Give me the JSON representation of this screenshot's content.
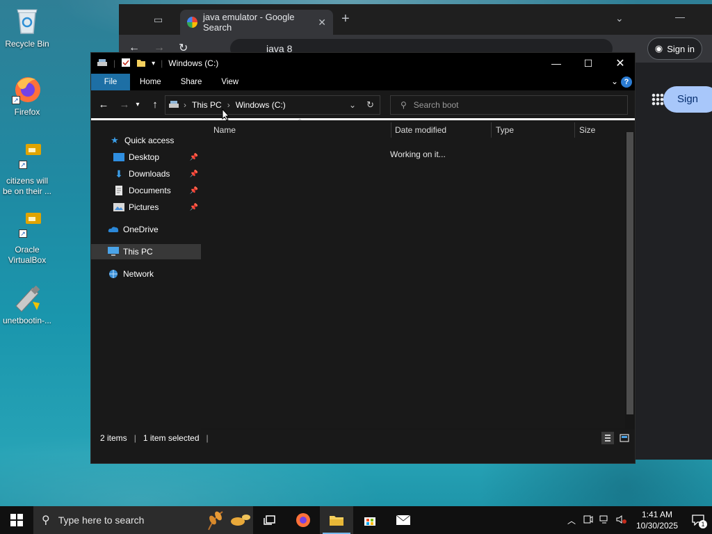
{
  "desktop": {
    "icons": [
      {
        "label": "Recycle Bin"
      },
      {
        "label": "Firefox"
      },
      {
        "label": "citizens will be on their ..."
      },
      {
        "label": "Oracle VirtualBox"
      },
      {
        "label": "unetbootin-..."
      }
    ]
  },
  "browser": {
    "tab_title": "java emulator - Google Search",
    "omnibox_text": "java 8",
    "signin_label": "Sign in",
    "signin_big_label": "Sign"
  },
  "explorer": {
    "window_title": "Windows (C:)",
    "ribbon_tabs": [
      "File",
      "Home",
      "Share",
      "View"
    ],
    "breadcrumb": [
      "This PC",
      "Windows (C:)"
    ],
    "search_placeholder": "Search boot",
    "nav": {
      "quick_access": "Quick access",
      "desktop": "Desktop",
      "downloads": "Downloads",
      "documents": "Documents",
      "pictures": "Pictures",
      "onedrive": "OneDrive",
      "this_pc": "This PC",
      "network": "Network"
    },
    "columns": [
      "Name",
      "Date modified",
      "Type",
      "Size"
    ],
    "working_text": "Working on it...",
    "status_items": "2 items",
    "status_selected": "1 item selected",
    "status_separator": "|"
  },
  "taskbar": {
    "search_placeholder": "Type here to search",
    "time": "1:41 AM",
    "date": "10/30/2025",
    "notification_count": "1"
  },
  "colors": {
    "file_tab": "#1d6fa5",
    "window_bg": "#191919",
    "taskbar_bg": "#101010",
    "accent": "#76b9ed"
  }
}
